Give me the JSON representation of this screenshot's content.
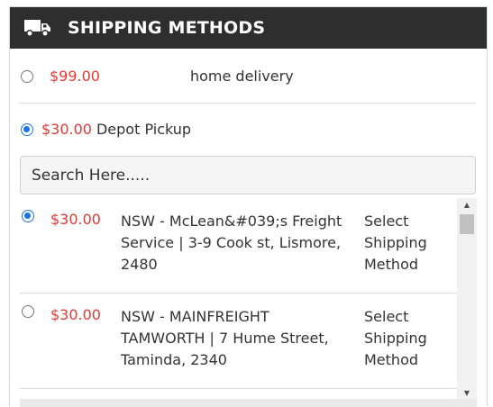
{
  "header": {
    "title": "SHIPPING METHODS",
    "icon": "truck-icon"
  },
  "options": [
    {
      "price": "$99.00",
      "label": "home delivery",
      "checked": false
    },
    {
      "price": "$30.00",
      "label": "Depot Pickup",
      "checked": true
    }
  ],
  "search": {
    "placeholder": "Search Here....."
  },
  "depots": [
    {
      "price": "$30.00",
      "address": "NSW - McLean&#039;s Freight Service | 3-9 Cook st, Lismore, 2480",
      "method": "Select Shipping Method",
      "checked": true
    },
    {
      "price": "$30.00",
      "address": "NSW - MAINFREIGHT TAMWORTH | 7 Hume Street, Taminda, 2340",
      "method": "Select Shipping Method",
      "checked": false
    }
  ],
  "colors": {
    "header_bg": "#2e2e2e",
    "price": "#e53935",
    "radio_checked": "#1a73e8"
  }
}
